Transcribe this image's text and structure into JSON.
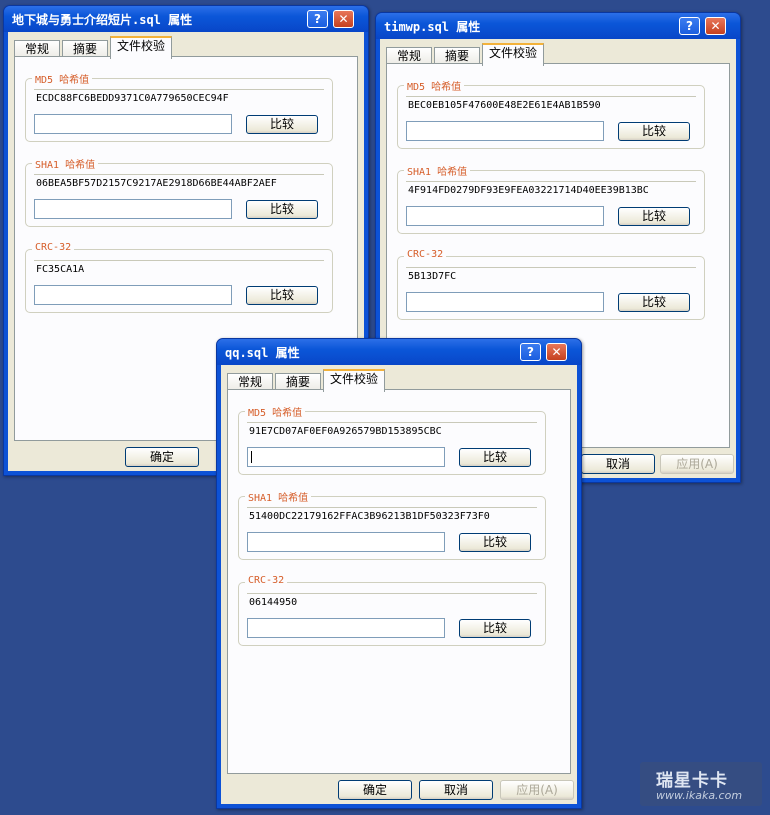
{
  "windows": [
    {
      "title": "地下城与勇士介绍短片.sql 属性",
      "tabs": [
        "常规",
        "摘要",
        "文件校验"
      ],
      "groups": [
        {
          "label": "MD5 哈希值",
          "value": "ECDC88FC6BEDD9371C0A779650CEC94F",
          "input": ""
        },
        {
          "label": "SHA1 哈希值",
          "value": "06BEA5BF57D2157C9217AE2918D66BE44ABF2AEF",
          "input": ""
        },
        {
          "label": "CRC-32",
          "value": "FC35CA1A",
          "input": ""
        }
      ],
      "compare_label": "比较",
      "buttons": {
        "ok": "确定"
      }
    },
    {
      "title": "timwp.sql 属性",
      "tabs": [
        "常规",
        "摘要",
        "文件校验"
      ],
      "groups": [
        {
          "label": "MD5 哈希值",
          "value": "BEC0EB105F47600E48E2E61E4AB1B590",
          "input": ""
        },
        {
          "label": "SHA1 哈希值",
          "value": "4F914FD0279DF93E9FEA03221714D40EE39B13BC",
          "input": ""
        },
        {
          "label": "CRC-32",
          "value": "5B13D7FC",
          "input": ""
        }
      ],
      "compare_label": "比较",
      "buttons": {
        "cancel": "取消",
        "apply": "应用(A)"
      }
    },
    {
      "title": "qq.sql 属性",
      "tabs": [
        "常规",
        "摘要",
        "文件校验"
      ],
      "groups": [
        {
          "label": "MD5 哈希值",
          "value": "91E7CD07AF0EF0A926579BD153895CBC",
          "input": ""
        },
        {
          "label": "SHA1 哈希值",
          "value": "51400DC22179162FFAC3B96213B1DF50323F73F0",
          "input": ""
        },
        {
          "label": "CRC-32",
          "value": "06144950",
          "input": ""
        }
      ],
      "compare_label": "比较",
      "buttons": {
        "ok": "确定",
        "cancel": "取消",
        "apply": "应用(A)"
      }
    }
  ],
  "titlebar_buttons": {
    "help": "?",
    "close": "✕"
  },
  "watermark": {
    "line1": "瑞星卡卡",
    "line2": "www.ikaka.com"
  }
}
